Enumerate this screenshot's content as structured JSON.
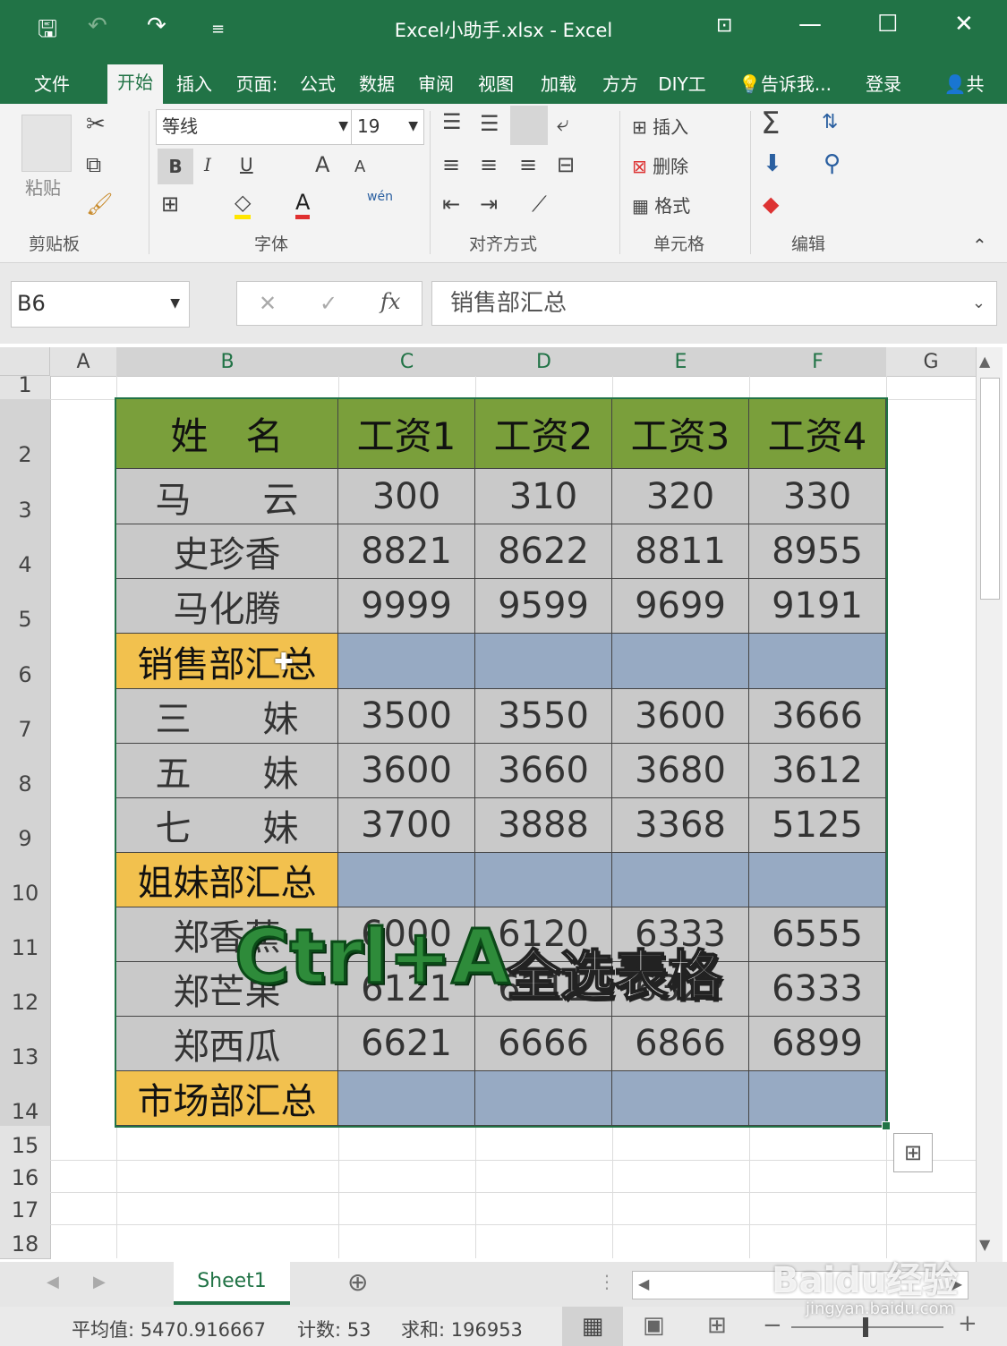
{
  "window": {
    "title": "Excel小助手.xlsx - Excel"
  },
  "tabs": [
    "文件",
    "开始",
    "插入",
    "页面:",
    "公式",
    "数据",
    "审阅",
    "视图",
    "加载",
    "方方",
    "DIY工",
    "告诉我...",
    "登录",
    "共"
  ],
  "ribbon": {
    "paste": "粘贴",
    "clipboard": "剪贴板",
    "font_name": "等线",
    "font_size": "19",
    "bold": "B",
    "italic": "I",
    "underline": "U",
    "grow": "A",
    "shrink": "A",
    "font_color": "A",
    "phonetic": "wén",
    "font_group": "字体",
    "align_group": "对齐方式",
    "insert": "插入",
    "delete": "删除",
    "format": "格式",
    "cells_group": "单元格",
    "sum": "Σ",
    "edit_group": "编辑"
  },
  "formula_bar": {
    "name_box": "B6",
    "fx": "fx",
    "cancel": "✕",
    "enter": "✓",
    "content": "销售部汇总"
  },
  "columns": [
    "A",
    "B",
    "C",
    "D",
    "E",
    "F",
    "G"
  ],
  "rows": [
    "1",
    "2",
    "3",
    "4",
    "5",
    "6",
    "7",
    "8",
    "9",
    "10",
    "11",
    "12",
    "13",
    "14",
    "15",
    "16",
    "17",
    "18"
  ],
  "table": {
    "header": [
      "姓　名",
      "工资1",
      "工资2",
      "工资3",
      "工资4"
    ],
    "r3": [
      "马　　云",
      "300",
      "310",
      "320",
      "330"
    ],
    "r4": [
      "史珍香",
      "8821",
      "8622",
      "8811",
      "8955"
    ],
    "r5": [
      "马化腾",
      "9999",
      "9599",
      "9699",
      "9191"
    ],
    "r6": [
      "销售部汇总",
      "",
      "",
      "",
      ""
    ],
    "r7": [
      "三　　妹",
      "3500",
      "3550",
      "3600",
      "3666"
    ],
    "r8": [
      "五　　妹",
      "3600",
      "3660",
      "3680",
      "3612"
    ],
    "r9": [
      "七　　妹",
      "3700",
      "3888",
      "3368",
      "5125"
    ],
    "r10": [
      "姐妹部汇总",
      "",
      "",
      "",
      ""
    ],
    "r11": [
      "郑香蕉",
      "6000",
      "6120",
      "6333",
      "6555"
    ],
    "r12": [
      "郑芒果",
      "6121",
      "6211",
      "6322",
      "6333"
    ],
    "r13": [
      "郑西瓜",
      "6621",
      "6666",
      "6866",
      "6899"
    ],
    "r14": [
      "市场部汇总",
      "",
      "",
      "",
      ""
    ]
  },
  "overlay": {
    "shortcut": "Ctrl+A",
    "desc": "全选表格"
  },
  "sheet_tab": "Sheet1",
  "status": {
    "average": "平均值: 5470.916667",
    "count": "计数: 53",
    "sum": "求和: 196953"
  },
  "watermark": {
    "brand": "Baidu经验",
    "url": "jingyan.baidu.com"
  },
  "colors": {
    "excel_green": "#217346",
    "header_green": "#7a9f3b",
    "summary_orange": "#f2c14e",
    "summary_blue": "#97aac3"
  }
}
